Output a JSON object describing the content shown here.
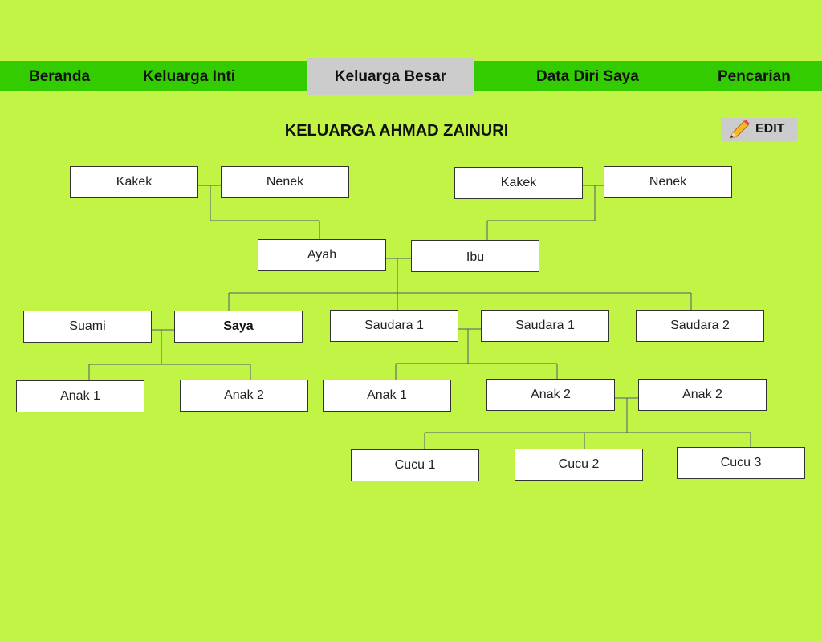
{
  "nav": {
    "items": [
      {
        "label": "Beranda"
      },
      {
        "label": "Keluarga Inti"
      },
      {
        "label": "Keluarga Besar",
        "active": true
      },
      {
        "label": "Data Diri Saya"
      },
      {
        "label": "Pencarian"
      }
    ]
  },
  "page": {
    "title": "KELUARGA AHMAD ZAINURI",
    "edit_label": "EDIT",
    "edit_icon": "pencil-icon"
  },
  "colors": {
    "background": "#c1f444",
    "nav": "#33cc00",
    "active_tab": "#cccccc",
    "node_fill": "#ffffff",
    "node_border": "#333333",
    "connector": "#4d5d73"
  },
  "tree": {
    "kakek_ayah": "Kakek",
    "nenek_ayah": "Nenek",
    "kakek_ibu": "Kakek",
    "nenek_ibu": "Nenek",
    "ayah": "Ayah",
    "ibu": "Ibu",
    "suami": "Suami",
    "saya": "Saya",
    "saudara1": "Saudara 1",
    "saudara1_spouse": "Saudara 1",
    "saudara2": "Saudara 2",
    "saya_anak1": "Anak 1",
    "saya_anak2": "Anak 2",
    "saudara_anak1": "Anak 1",
    "saudara_anak2": "Anak 2",
    "saudara_anak2_spouse": "Anak 2",
    "cucu1": "Cucu 1",
    "cucu2": "Cucu 2",
    "cucu3": "Cucu 3"
  }
}
